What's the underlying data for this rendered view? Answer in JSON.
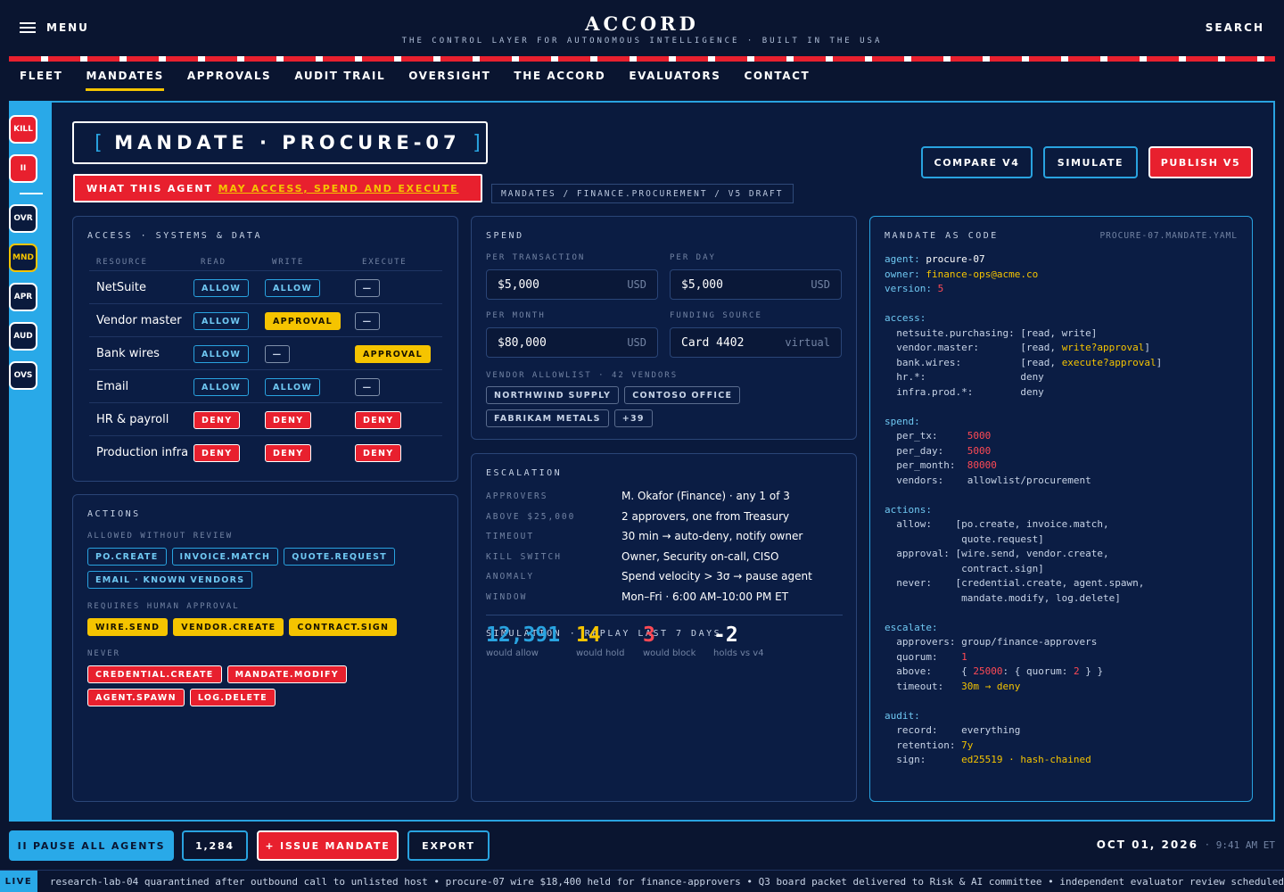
{
  "header": {
    "menu_label": "MENU",
    "brand": "ACCORD",
    "tagline": "THE CONTROL LAYER FOR AUTONOMOUS INTELLIGENCE · BUILT IN THE USA",
    "search_label": "SEARCH"
  },
  "nav": {
    "items": [
      "FLEET",
      "MANDATES",
      "APPROVALS",
      "AUDIT TRAIL",
      "OVERSIGHT",
      "THE ACCORD",
      "EVALUATORS",
      "CONTACT"
    ],
    "active": "MANDATES"
  },
  "rail": {
    "items": [
      "KILL",
      "II",
      "OVR",
      "MND",
      "APR",
      "AUD",
      "OVS"
    ]
  },
  "mandate": {
    "title": "MANDATE · PROCURE-07",
    "subtitle_prefix": "WHAT THIS AGENT",
    "subtitle_highlight": "MAY ACCESS, SPEND AND EXECUTE",
    "breadcrumb": "MANDATES / FINANCE.PROCUREMENT / V5 DRAFT"
  },
  "toolbar": {
    "compare": "COMPARE V4",
    "simulate": "SIMULATE",
    "publish": "PUBLISH V5"
  },
  "access": {
    "heading": "ACCESS · SYSTEMS & DATA",
    "columns": [
      "RESOURCE",
      "READ",
      "WRITE",
      "EXECUTE"
    ],
    "rows": [
      {
        "resource": "NetSuite",
        "read": "ALLOW",
        "write": "ALLOW",
        "execute": "—"
      },
      {
        "resource": "Vendor master",
        "read": "ALLOW",
        "write": "APPROVAL",
        "execute": "—"
      },
      {
        "resource": "Bank wires",
        "read": "ALLOW",
        "write": "—",
        "execute": "APPROVAL"
      },
      {
        "resource": "Email",
        "read": "ALLOW",
        "write": "ALLOW",
        "execute": "—"
      },
      {
        "resource": "HR & payroll",
        "read": "DENY",
        "write": "DENY",
        "execute": "DENY"
      },
      {
        "resource": "Production infra",
        "read": "DENY",
        "write": "DENY",
        "execute": "DENY"
      }
    ]
  },
  "actions": {
    "heading": "ACTIONS",
    "allowed_label": "ALLOWED WITHOUT REVIEW",
    "allowed": [
      "PO.CREATE",
      "INVOICE.MATCH",
      "QUOTE.REQUEST",
      "EMAIL · KNOWN VENDORS"
    ],
    "approval_label": "REQUIRES HUMAN APPROVAL",
    "approval": [
      "WIRE.SEND",
      "VENDOR.CREATE",
      "CONTRACT.SIGN"
    ],
    "never_label": "NEVER",
    "never": [
      "CREDENTIAL.CREATE",
      "MANDATE.MODIFY",
      "AGENT.SPAWN",
      "LOG.DELETE"
    ]
  },
  "spend": {
    "heading": "SPEND",
    "per_tx_label": "PER TRANSACTION",
    "per_tx": "$5,000",
    "per_day_label": "PER DAY",
    "per_day": "$5,000",
    "per_month_label": "PER MONTH",
    "per_month": "$80,000",
    "currency": "USD",
    "funding_label": "FUNDING SOURCE",
    "funding": "Card 4402",
    "funding_type": "virtual",
    "allowlist_label": "VENDOR ALLOWLIST · 42 VENDORS",
    "vendors": [
      "NORTHWIND SUPPLY",
      "CONTOSO OFFICE",
      "FABRIKAM METALS",
      "+39"
    ]
  },
  "escalation": {
    "heading": "ESCALATION",
    "rows": [
      {
        "k": "APPROVERS",
        "v": "M. Okafor (Finance) · any 1 of 3"
      },
      {
        "k": "ABOVE $25,000",
        "v": "2 approvers, one from Treasury"
      },
      {
        "k": "TIMEOUT",
        "v": "30 min → auto-deny, notify owner"
      },
      {
        "k": "KILL SWITCH",
        "v": "Owner, Security on-call, CISO"
      },
      {
        "k": "ANOMALY",
        "v": "Spend velocity > 3σ → pause agent"
      },
      {
        "k": "WINDOW",
        "v": "Mon–Fri · 6:00 AM–10:00 PM ET"
      }
    ],
    "simulation_label": "SIMULATION · REPLAY LAST 7 DAYS",
    "stats": [
      {
        "n": "12,391",
        "s": "would allow",
        "color": "#29a3e0"
      },
      {
        "n": "14",
        "s": "would hold",
        "color": "#f5c400"
      },
      {
        "n": "3",
        "s": "would block",
        "color": "#ff4a55"
      },
      {
        "n": "-2",
        "s": "holds vs v4",
        "color": "#ffffff"
      }
    ]
  },
  "code": {
    "heading": "MANDATE AS CODE",
    "file": "PROCURE-07.MANDATE.YAML"
  },
  "bottom": {
    "pause": "II PAUSE ALL AGENTS",
    "count": "1,284",
    "issue": "+ ISSUE MANDATE",
    "export": "EXPORT",
    "date": "OCT 01, 2026",
    "time": "9:41 AM ET"
  },
  "ticker": {
    "live": "LIVE",
    "text": "research-lab-04 quarantined after outbound call to unlisted host • procure-07 wire $18,400 held for finance-approvers • Q3 board packet delivered to Risk & AI committee • independent evaluator review scheduled"
  }
}
